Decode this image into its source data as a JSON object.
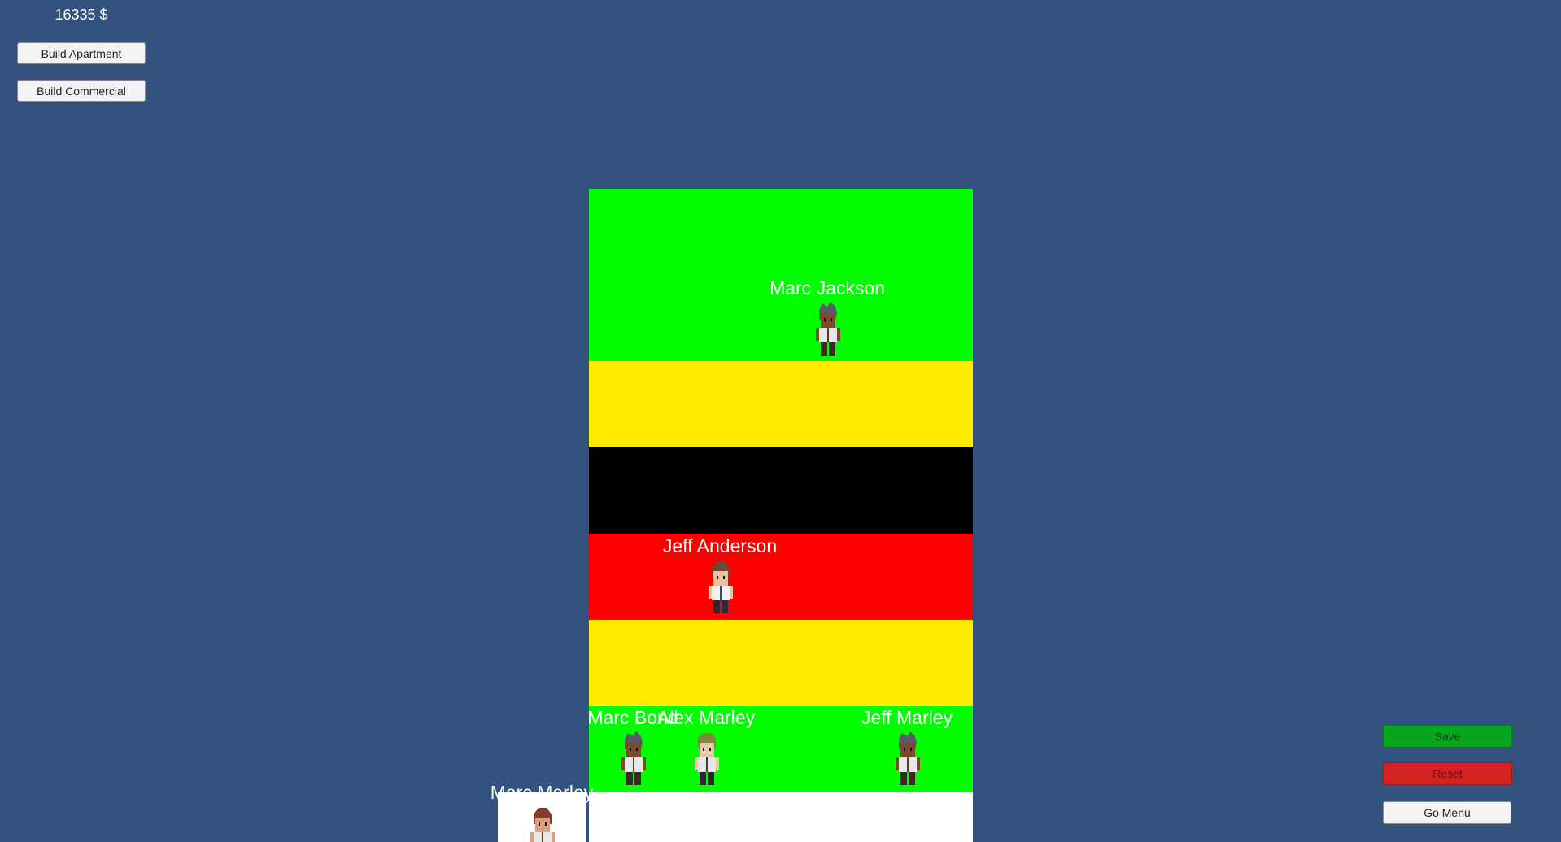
{
  "hud": {
    "money": "16335 $"
  },
  "build_menu": {
    "apartment_label": "Build Apartment",
    "commercial_label": "Build Commercial"
  },
  "controls": {
    "save_label": "Save",
    "reset_label": "Reset",
    "menu_label": "Go Menu"
  },
  "colors": {
    "background": "#33527d",
    "floor_green": "#00ff00",
    "floor_yellow": "#ffea00",
    "floor_black": "#000000",
    "floor_red": "#ff0000",
    "floor_white": "#ffffff",
    "save_button": "#0aa51e",
    "reset_button": "#d42323"
  },
  "tower": {
    "floors": [
      "green",
      "yellow",
      "black",
      "red",
      "yellow",
      "green",
      "white"
    ]
  },
  "residents": [
    {
      "name": "Marc Jackson",
      "hair": "gray",
      "skin": "dark"
    },
    {
      "name": "Jeff Anderson",
      "hair": "brown",
      "skin": "light"
    },
    {
      "name": "Marc Bond",
      "hair": "gray",
      "skin": "dark"
    },
    {
      "name": "Alex Marley",
      "hair": "olive",
      "skin": "light"
    },
    {
      "name": "Jeff Marley",
      "hair": "gray",
      "skin": "dark"
    },
    {
      "name": "Marc Marley",
      "hair": "red",
      "skin": "light"
    }
  ]
}
